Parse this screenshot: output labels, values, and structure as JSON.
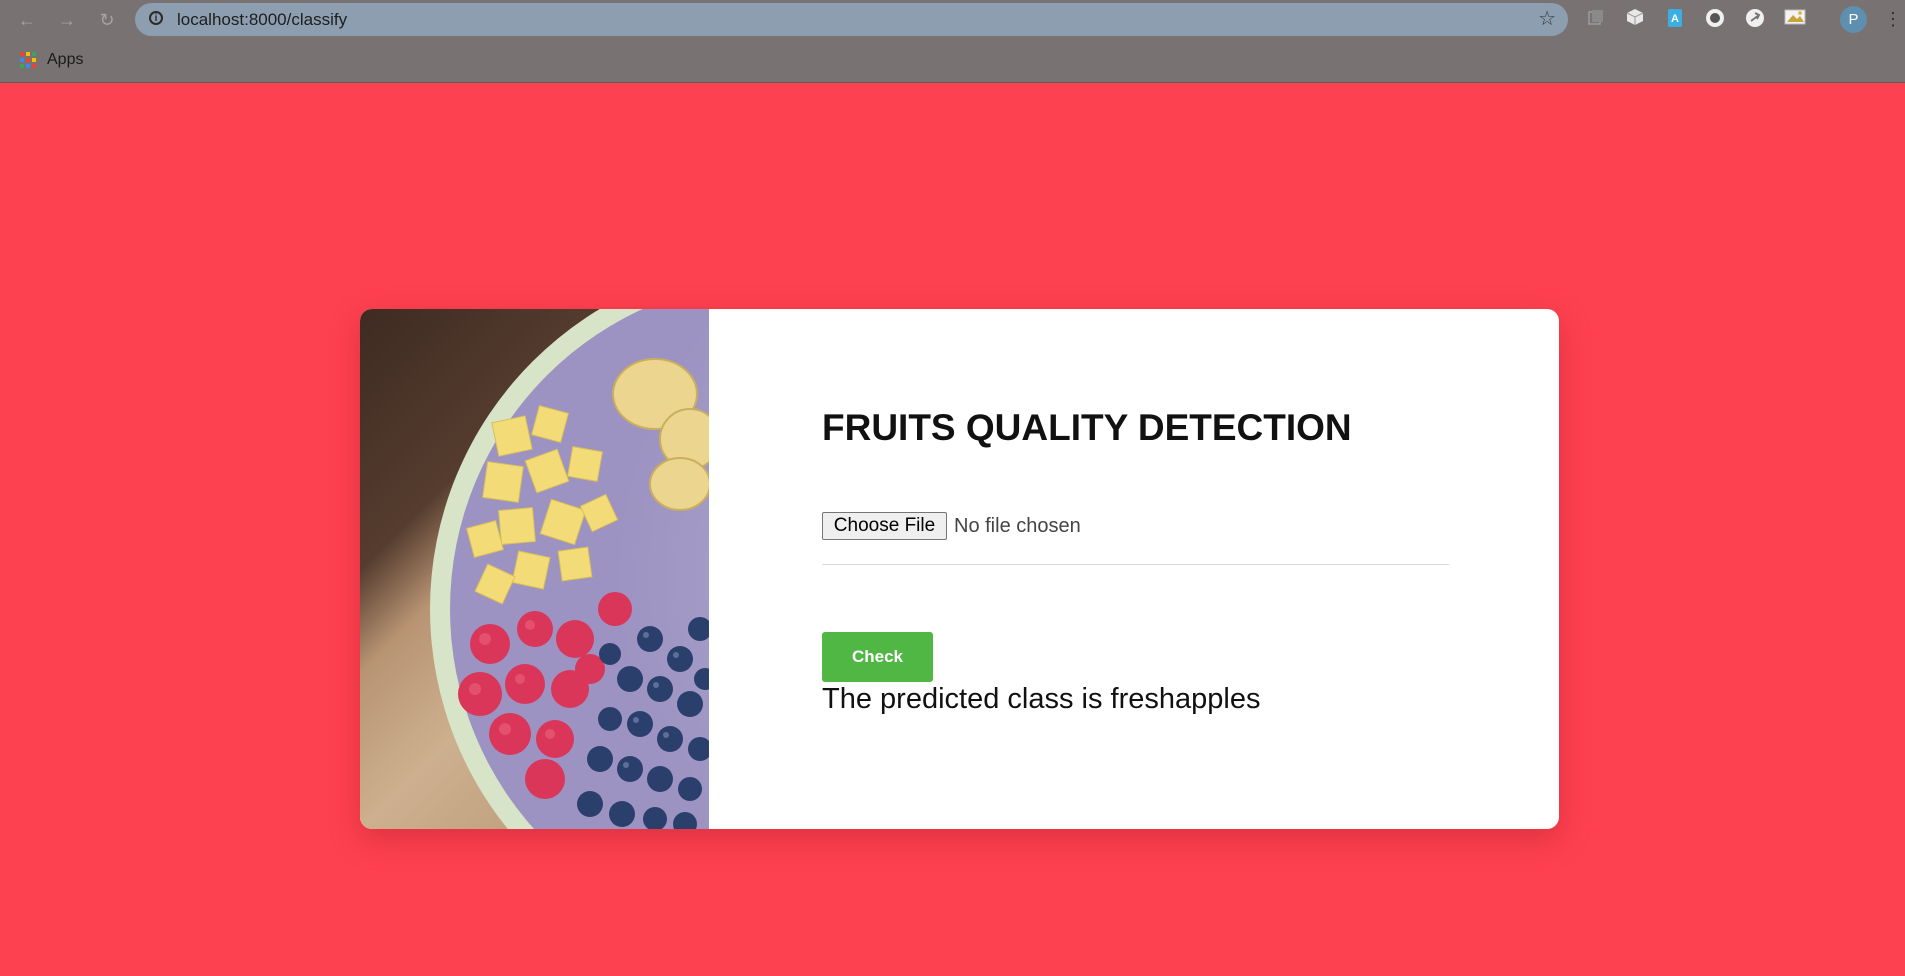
{
  "browser": {
    "url": "localhost:8000/classify",
    "bookmarks": {
      "apps_label": "Apps"
    },
    "profile_initial": "P",
    "extensions": [
      "extension-icon-1",
      "extension-icon-2",
      "extension-icon-3",
      "extension-icon-4",
      "extension-icon-5",
      "extension-icon-6"
    ]
  },
  "page": {
    "title": "FRUITS QUALITY DETECTION",
    "file_input": {
      "button_label": "Choose File",
      "status": "No file chosen"
    },
    "check_button": "Check",
    "result": "The predicted class is freshapples"
  },
  "colors": {
    "background": "#fe4151",
    "check_button": "#50b744",
    "card": "#ffffff"
  }
}
